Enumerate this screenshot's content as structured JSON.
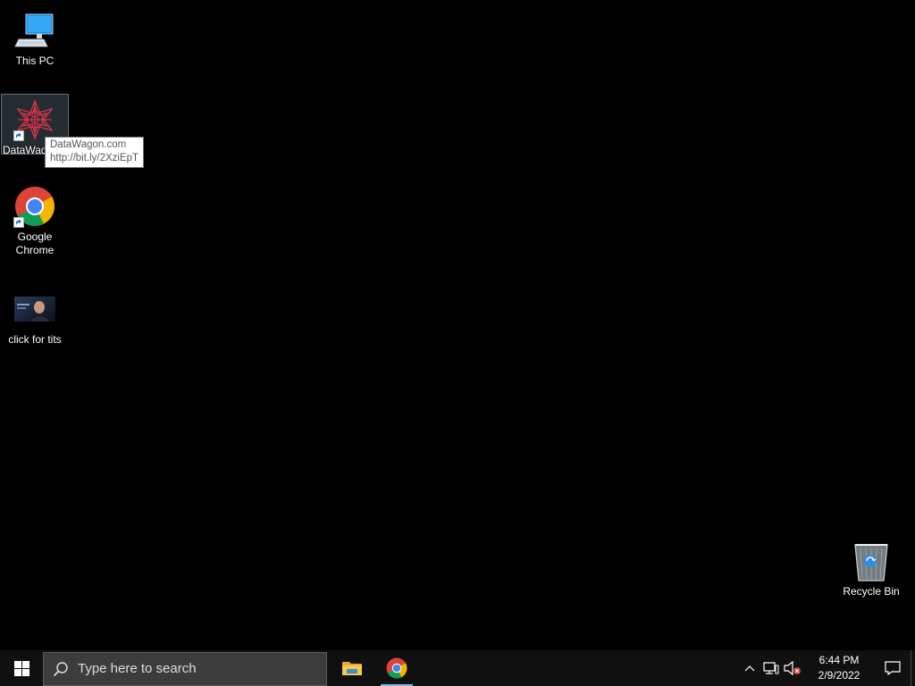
{
  "desktop": {
    "icons": [
      {
        "label": "This PC",
        "icon": "computer-icon"
      },
      {
        "label": "DataWagon.com",
        "icon": "datawagon-icon",
        "visible_label": "DataWag"
      },
      {
        "label": "Google Chrome",
        "icon": "chrome-icon"
      },
      {
        "label": "click for tits",
        "icon": "image-thumbnail-icon"
      }
    ],
    "recycle_bin": {
      "label": "Recycle Bin",
      "icon": "recycle-bin-icon"
    }
  },
  "tooltip": {
    "line1": "DataWagon.com",
    "line2": "http://bit.ly/2XziEpT"
  },
  "taskbar": {
    "search": {
      "placeholder": "Type here to search"
    },
    "pinned": [
      {
        "name": "File Explorer",
        "icon": "folder-icon"
      },
      {
        "name": "Google Chrome",
        "icon": "chrome-icon",
        "active": true
      }
    ],
    "clock": {
      "time": "6:44 PM",
      "date": "2/9/2022"
    },
    "accent_color": "#76b9ed"
  }
}
